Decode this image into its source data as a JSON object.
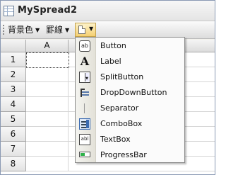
{
  "window": {
    "title": "MySpread2"
  },
  "toolbar": {
    "items": [
      {
        "label": "背景色",
        "arrow": "▼"
      },
      {
        "label": "罫線",
        "arrow": "▼"
      }
    ],
    "dropdown_arrow": "▼"
  },
  "grid": {
    "columns": [
      "A"
    ],
    "rows": [
      "1",
      "2",
      "3",
      "4",
      "5",
      "6",
      "7",
      "8"
    ],
    "selected_cell": "A1"
  },
  "menu": {
    "items": [
      {
        "label": "Button",
        "icon": "button-icon",
        "glyph": "ab"
      },
      {
        "label": "Label",
        "icon": "label-icon",
        "glyph": "A"
      },
      {
        "label": "SplitButton",
        "icon": "splitbutton-icon",
        "glyph": "▼"
      },
      {
        "label": "DropDownButton",
        "icon": "dropdownbutton-icon"
      },
      {
        "label": "Separator",
        "icon": "separator-icon"
      },
      {
        "label": "ComboBox",
        "icon": "combobox-icon"
      },
      {
        "label": "TextBox",
        "icon": "textbox-icon",
        "glyph": "abl"
      },
      {
        "label": "ProgressBar",
        "icon": "progressbar-icon"
      }
    ]
  },
  "colors": {
    "menu_highlight": "#f5cf72",
    "progress_fill": "#2fb24a"
  }
}
